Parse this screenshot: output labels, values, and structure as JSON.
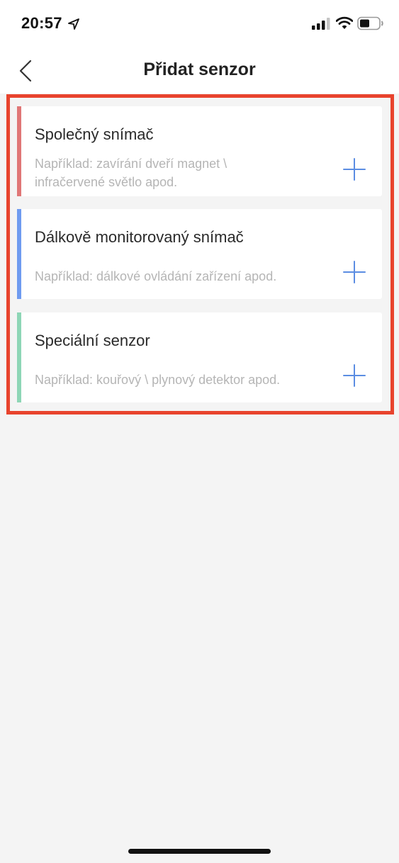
{
  "status_bar": {
    "time": "20:57",
    "icons": [
      "location-arrow-icon",
      "cellular-signal-icon",
      "wifi-icon",
      "battery-icon"
    ]
  },
  "nav": {
    "title": "Přidat senzor",
    "back_icon": "chevron-left-icon"
  },
  "colors": {
    "highlight": "#e8432d",
    "accent_blue": "#5b8de2",
    "common_bar": "#e07777",
    "remote_bar": "#6f9bf0",
    "special_bar": "#8ed6b6"
  },
  "sensors": [
    {
      "title": "Společný snímač",
      "description_line1": "Například: zavírání dveří magnet \\",
      "description_line2": "infračervené světlo apod.",
      "bar_color": "#e07777"
    },
    {
      "title": "Dálkově monitorovaný snímač",
      "description": "Například: dálkové ovládání zařízení apod.",
      "bar_color": "#6f9bf0"
    },
    {
      "title": "Speciální senzor",
      "description": "Například: kouřový \\ plynový detektor apod.",
      "bar_color": "#8ed6b6"
    }
  ]
}
